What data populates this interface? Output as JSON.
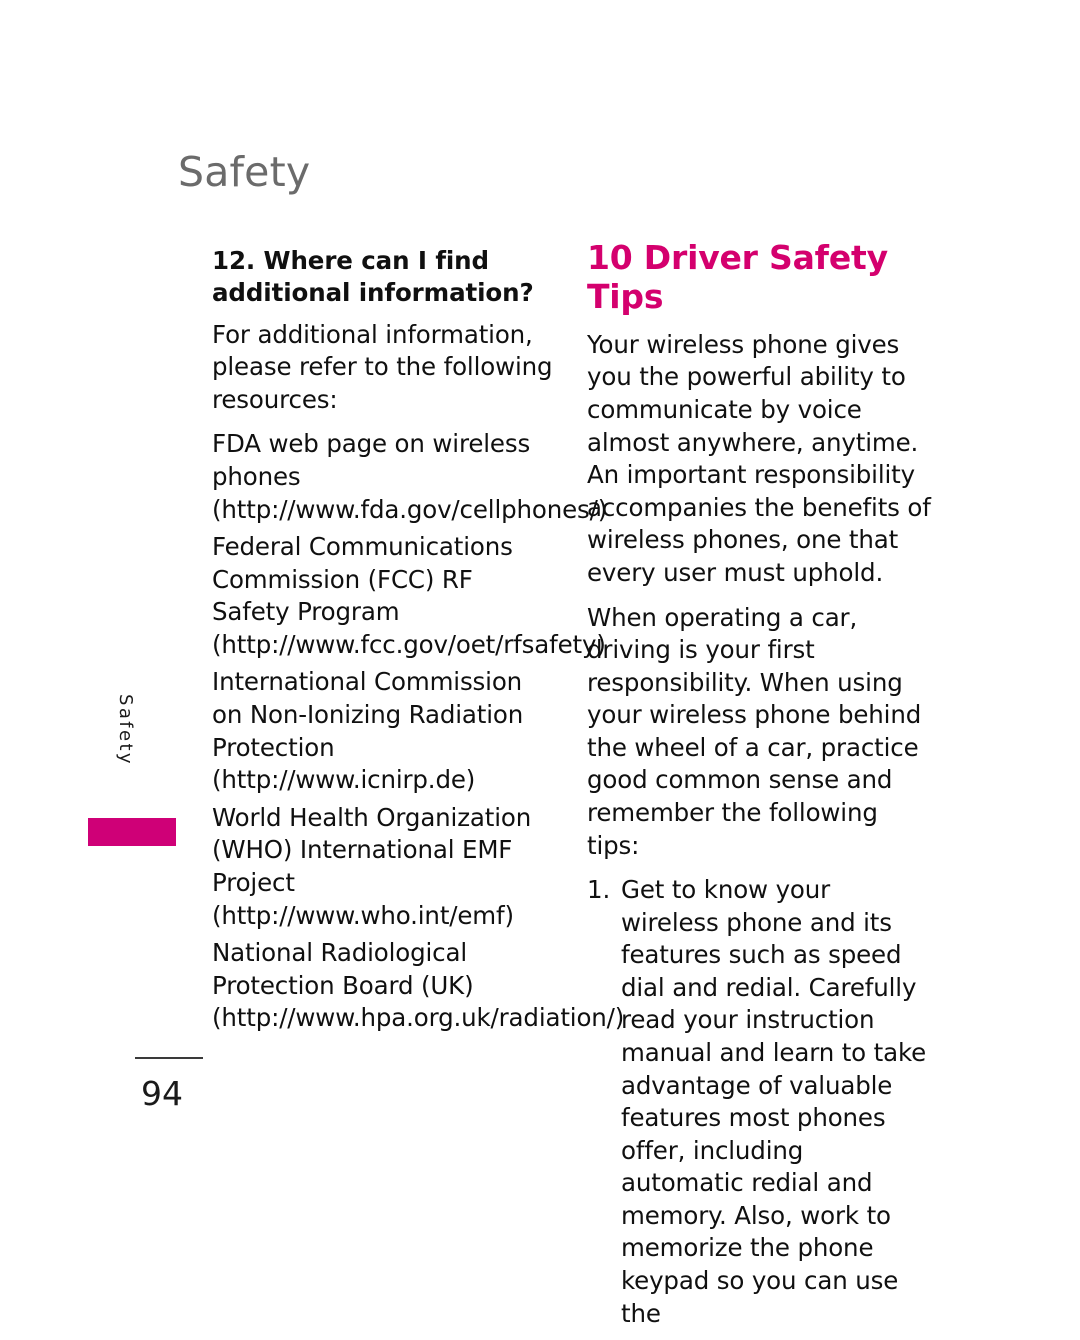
{
  "header": {
    "running_title": "Safety"
  },
  "side_tab": {
    "label": "Safety",
    "bar_color": "#cf0077"
  },
  "folio": {
    "page_number": "94"
  },
  "left_column": {
    "heading": "12. Where can I find additional information?",
    "intro": "For additional information, please refer to the following resources:",
    "resources": [
      "FDA web page on wireless phones (http://www.fda.gov/cellphones/)",
      "Federal Communications Commission (FCC) RF Safety Program (http://www.fcc.gov/oet/rfsafety)",
      "International Commission on Non-Ionizing Radiation Protection (http://www.icnirp.de)",
      "World Health Organization (WHO) International EMF Project (http://www.who.int/emf)",
      "National Radiological Protection Board (UK) (http://www.hpa.org.uk/radiation/)"
    ]
  },
  "right_column": {
    "heading": "10 Driver Safety Tips",
    "heading_color": "#d4006e",
    "paragraphs": [
      "Your wireless phone gives you the powerful ability to communicate by voice almost anywhere, anytime. An important responsibility accompanies the benefits of wireless phones, one that every user must uphold.",
      "When operating a car, driving is your first responsibility. When using your wireless phone behind the wheel of a car, practice good common sense and remember the following tips:"
    ],
    "tips": [
      {
        "marker": "1.",
        "text": "Get to know your wireless phone and its features such as speed dial and redial. Carefully read your instruction manual and learn to take advantage of valuable features most phones offer, including automatic redial and memory. Also, work to memorize the phone keypad so you can use the"
      }
    ]
  }
}
